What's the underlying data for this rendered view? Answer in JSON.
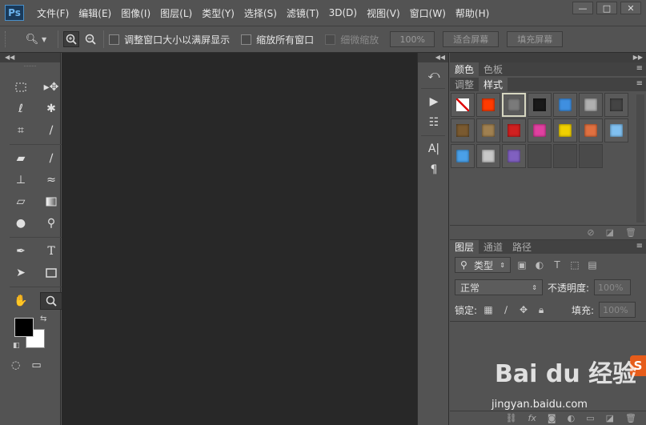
{
  "app": {
    "logo": "Ps"
  },
  "menu": [
    "文件(F)",
    "编辑(E)",
    "图像(I)",
    "图层(L)",
    "类型(Y)",
    "选择(S)",
    "滤镜(T)",
    "3D(D)",
    "视图(V)",
    "窗口(W)",
    "帮助(H)"
  ],
  "window_controls": {
    "minimize": "—",
    "maximize": "□",
    "close": "✕"
  },
  "options": {
    "tool_icon": "zoom-icon",
    "resize_windows_label": "调整窗口大小以满屏显示",
    "zoom_all_windows_label": "缩放所有窗口",
    "scrubby_zoom_label": "细微缩放",
    "percent_button": "100%",
    "fit_screen_button": "适合屏幕",
    "fill_screen_button": "填充屏幕"
  },
  "panels": {
    "color_tabs": [
      "颜色",
      "色板"
    ],
    "style_tabs": [
      "调整",
      "样式"
    ],
    "layers_tabs": [
      "图层",
      "通道",
      "路径"
    ],
    "filter_kind": "类型",
    "blend_mode": "正常",
    "opacity_label": "不透明度:",
    "opacity_value": "100%",
    "lock_label": "锁定:",
    "fill_label": "填充:",
    "fill_value": "100%"
  },
  "styles": [
    {
      "name": "none-style",
      "color": "#ffffff"
    },
    {
      "name": "red-glow-style",
      "color": "#ff3b00"
    },
    {
      "name": "gray-bevel-style",
      "color": "#7a7a7a"
    },
    {
      "name": "black-emboss-style",
      "color": "#1a1a1a"
    },
    {
      "name": "blue-glass-style",
      "color": "#3f8fe0"
    },
    {
      "name": "silver-style",
      "color": "#b0b0b0"
    },
    {
      "name": "dark-metal-style",
      "color": "#444444"
    },
    {
      "name": "brown-texture-style",
      "color": "#7a5a30"
    },
    {
      "name": "tan-texture-style",
      "color": "#a08050"
    },
    {
      "name": "red-button-style",
      "color": "#d02020"
    },
    {
      "name": "rainbow-style",
      "color": "#e040a0"
    },
    {
      "name": "yellow-frame-style",
      "color": "#f0d000"
    },
    {
      "name": "orange-gradient-style",
      "color": "#e07040"
    },
    {
      "name": "light-blue-style",
      "color": "#80c0f0"
    },
    {
      "name": "sky-style",
      "color": "#4aa0e8"
    },
    {
      "name": "pattern-style",
      "color": "#c8c8c8"
    },
    {
      "name": "purple-style",
      "color": "#8060c0"
    },
    {
      "name": "empty-style-1",
      "color": "#4a4a4a"
    },
    {
      "name": "empty-style-2",
      "color": "#4a4a4a"
    },
    {
      "name": "empty-style-3",
      "color": "#4a4a4a"
    }
  ],
  "watermark": {
    "brand": "Bai du 经验",
    "url": "jingyan.baidu.com",
    "badge": "S"
  }
}
